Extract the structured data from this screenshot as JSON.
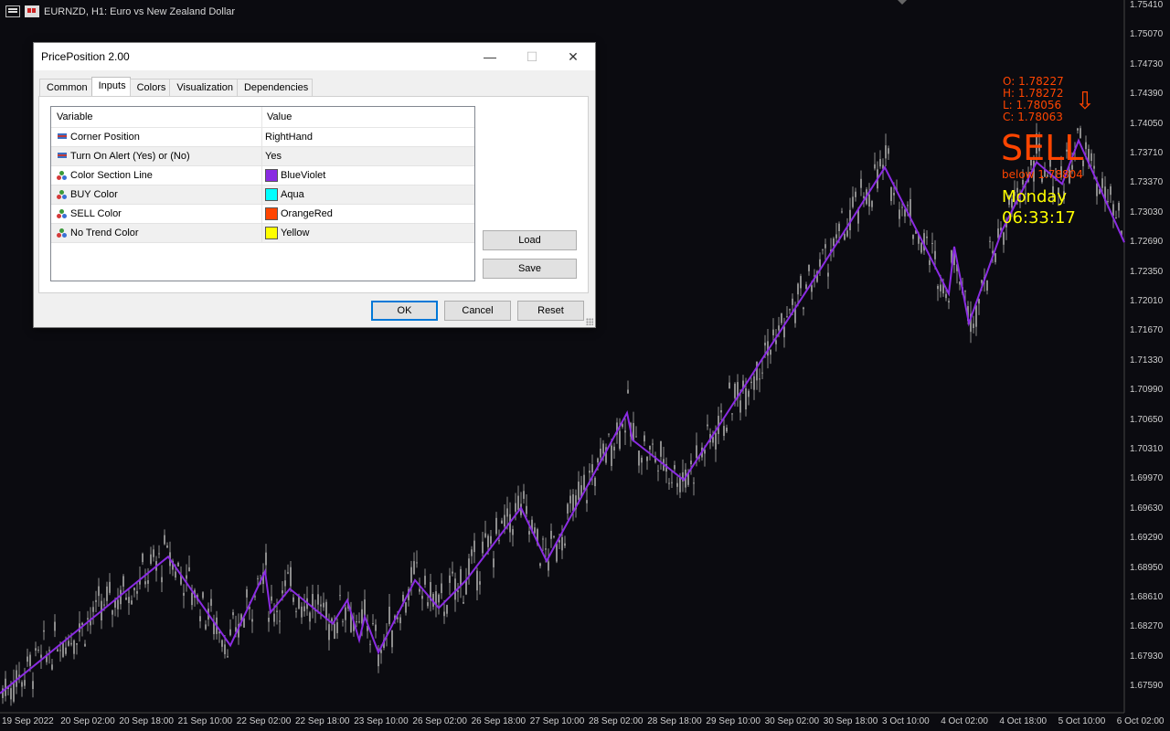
{
  "chart": {
    "title": "EURNZD, H1:  Euro vs New Zealand Dollar",
    "price_axis": [
      "1.75410",
      "1.75070",
      "1.74730",
      "1.74390",
      "1.74050",
      "1.73710",
      "1.73370",
      "1.73030",
      "1.72690",
      "1.72350",
      "1.72010",
      "1.71670",
      "1.71330",
      "1.70990",
      "1.70650",
      "1.70310",
      "1.69970",
      "1.69630",
      "1.69290",
      "1.68950",
      "1.68610",
      "1.68270",
      "1.67930",
      "1.67590"
    ],
    "time_axis": [
      "19 Sep 2022",
      "20 Sep 02:00",
      "20 Sep 18:00",
      "21 Sep 10:00",
      "22 Sep 02:00",
      "22 Sep 18:00",
      "23 Sep 10:00",
      "26 Sep 02:00",
      "26 Sep 18:00",
      "27 Sep 10:00",
      "28 Sep 02:00",
      "28 Sep 18:00",
      "29 Sep 10:00",
      "30 Sep 02:00",
      "30 Sep 18:00",
      "3 Oct 10:00",
      "4 Oct 02:00",
      "4 Oct 18:00",
      "5 Oct 10:00",
      "6 Oct 02:00"
    ],
    "colors": {
      "background": "#0b0b10",
      "candle": "#8c8c8c",
      "section_line": "#8a2be2",
      "sell": "#ff4500",
      "clock": "#ffff00"
    },
    "section_line_points": [
      [
        0,
        1.675
      ],
      [
        184,
        1.6907
      ],
      [
        252,
        1.6805
      ],
      [
        290,
        1.689
      ],
      [
        296,
        1.6843
      ],
      [
        317,
        1.687
      ],
      [
        364,
        1.683
      ],
      [
        380,
        1.6857
      ],
      [
        393,
        1.6811
      ],
      [
        399,
        1.6838
      ],
      [
        414,
        1.6797
      ],
      [
        454,
        1.688
      ],
      [
        480,
        1.6848
      ],
      [
        510,
        1.688
      ],
      [
        570,
        1.6963
      ],
      [
        598,
        1.6902
      ],
      [
        686,
        1.7072
      ],
      [
        692,
        1.7041
      ],
      [
        748,
        1.6995
      ],
      [
        892,
        1.7228
      ],
      [
        968,
        1.7354
      ],
      [
        1038,
        1.7209
      ],
      [
        1044,
        1.7263
      ],
      [
        1060,
        1.7175
      ],
      [
        1096,
        1.7281
      ],
      [
        1134,
        1.736
      ],
      [
        1162,
        1.7335
      ],
      [
        1180,
        1.7385
      ],
      [
        1230,
        1.7268
      ]
    ]
  },
  "overlay": {
    "ohlc": [
      "O: 1.78227",
      "H: 1.78272",
      "L: 1.78056",
      "C: 1.78063"
    ],
    "signal": "SELL",
    "below": "below 1.78804",
    "arrow": "⇩",
    "day": "Monday",
    "time": "06:33:17"
  },
  "dialog": {
    "title": "PricePosition 2.00",
    "minimize": "—",
    "maximize": "☐",
    "close": "✕",
    "tabs": [
      "Common",
      "Inputs",
      "Colors",
      "Visualization",
      "Dependencies"
    ],
    "active_tab": "Inputs",
    "columns": [
      "Variable",
      "Value"
    ],
    "rows": [
      {
        "variable": "Corner Position",
        "value": "RightHand",
        "icon": "lines-icon",
        "swatch": ""
      },
      {
        "variable": "Turn On Alert (Yes) or (No)",
        "value": "Yes",
        "icon": "lines-icon",
        "swatch": ""
      },
      {
        "variable": "Color Section Line",
        "value": "BlueViolet",
        "icon": "palette-icon",
        "swatch": "#8a2be2"
      },
      {
        "variable": "BUY Color",
        "value": "Aqua",
        "icon": "palette-icon",
        "swatch": "#00ffff"
      },
      {
        "variable": "SELL Color",
        "value": "OrangeRed",
        "icon": "palette-icon",
        "swatch": "#ff4500"
      },
      {
        "variable": "No Trend Color",
        "value": "Yellow",
        "icon": "palette-icon",
        "swatch": "#ffff00"
      }
    ],
    "load_label": "Load",
    "save_label": "Save",
    "ok_label": "OK",
    "cancel_label": "Cancel",
    "reset_label": "Reset"
  }
}
